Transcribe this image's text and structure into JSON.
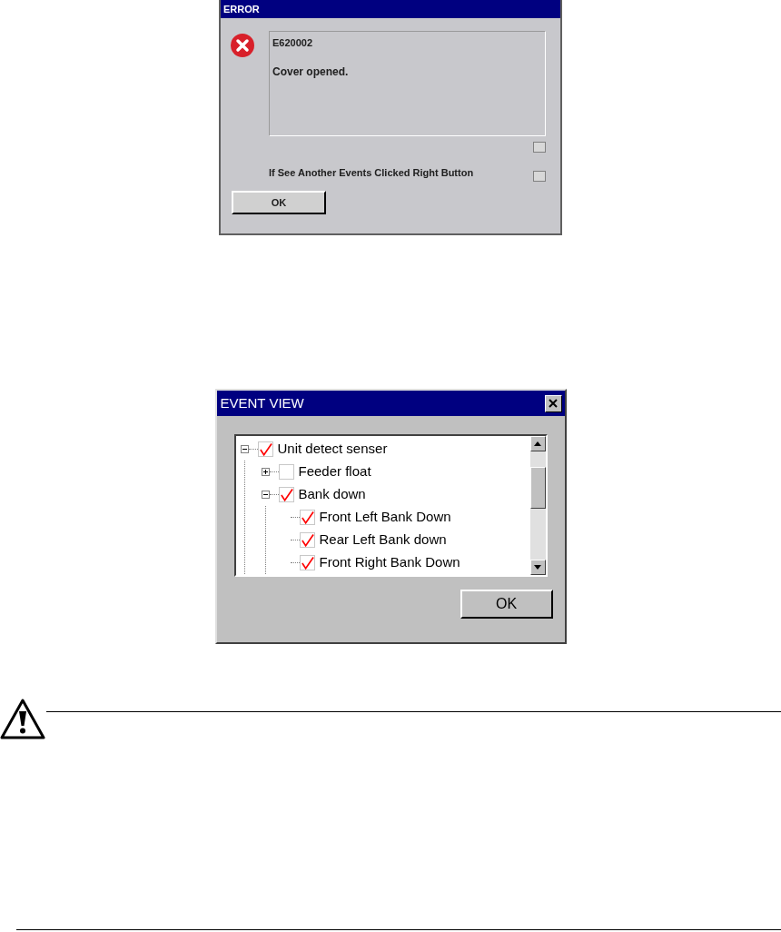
{
  "error_dialog": {
    "title": "ERROR",
    "code": "E620002",
    "message": "Cover opened.",
    "hint": "If See Another Events Clicked Right Button",
    "ok_button": "OK"
  },
  "event_view": {
    "title": "EVENT VIEW",
    "tree": [
      {
        "label": "Unit detect senser",
        "checked": true,
        "expanded": true,
        "children": [
          {
            "label": "Feeder float",
            "checked": false,
            "expanded": false
          },
          {
            "label": "Bank down",
            "checked": true,
            "expanded": true,
            "children": [
              {
                "label": "Front Left Bank Down",
                "checked": true
              },
              {
                "label": "Rear Left Bank down",
                "checked": true
              },
              {
                "label": "Front Right Bank Down",
                "checked": true
              }
            ]
          }
        ]
      }
    ],
    "ok_button": "OK"
  }
}
